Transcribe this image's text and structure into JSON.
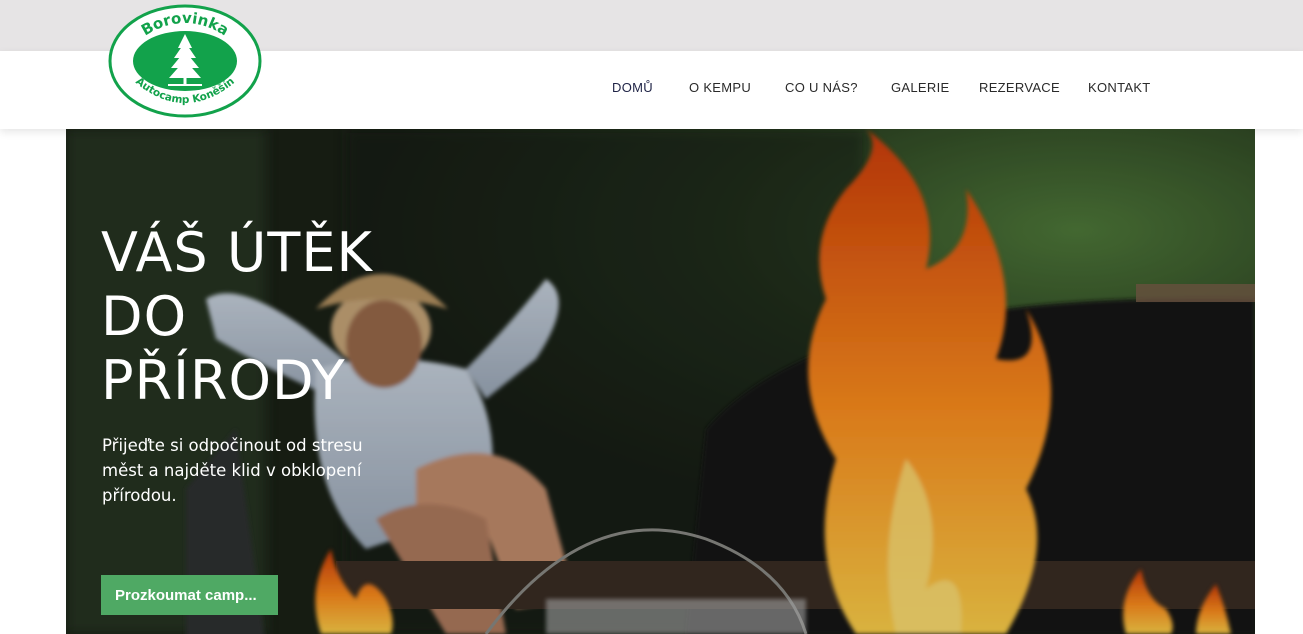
{
  "logo": {
    "name": "Borovinka",
    "subtitle": "Autocamp Koněšín"
  },
  "nav": {
    "items": [
      {
        "label": "DOMŮ",
        "active": true
      },
      {
        "label": "O KEMPU"
      },
      {
        "label": "CO U NÁS?"
      },
      {
        "label": "GALERIE"
      },
      {
        "label": "REZERVACE"
      },
      {
        "label": "KONTAKT"
      }
    ]
  },
  "hero": {
    "title_lines": [
      "VÁŠ ÚTĚK",
      "DO",
      "PŘÍRODY"
    ],
    "subtitle": "Přijeďte si odpočinout od stresu měst a najděte klid v obklopení přírodou.",
    "button_label": "Prozkoumat camp...",
    "image": "woman-relaxing-by-campfire"
  },
  "colors": {
    "brand_green": "#12a24b",
    "button_green": "#4fa964",
    "topbar": "#e6e4e5",
    "nav_active": "#1f2346"
  }
}
